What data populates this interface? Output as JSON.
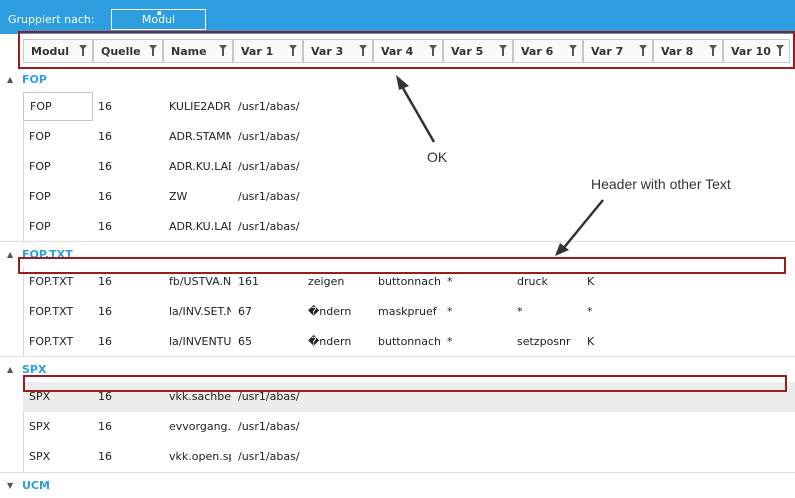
{
  "toolbar": {
    "group_by_label": "Gruppiert nach:",
    "group_chip": "Modul"
  },
  "columns": [
    "Modul",
    "Quelle",
    "Name",
    "Var 1",
    "Var 3",
    "Var 4",
    "Var 5",
    "Var 6",
    "Var 7",
    "Var 8",
    "Var 10"
  ],
  "groups": [
    {
      "name": "FOP",
      "rows": [
        [
          "FOP",
          "16",
          "KULIE2ADR",
          "/usr1/abas/",
          "",
          "",
          "",
          "",
          ""
        ],
        [
          "FOP",
          "16",
          "ADR.STAMM",
          "/usr1/abas/",
          "",
          "",
          "",
          "",
          ""
        ],
        [
          "FOP",
          "16",
          "ADR.KU.LAD",
          "/usr1/abas/",
          "",
          "",
          "",
          "",
          ""
        ],
        [
          "FOP",
          "16",
          "ZW",
          "/usr1/abas/",
          "",
          "",
          "",
          "",
          ""
        ],
        [
          "FOP",
          "16",
          "ADR.KU.LAD",
          "/usr1/abas/",
          "",
          "",
          "",
          "",
          ""
        ]
      ]
    },
    {
      "name": "FOP.TXT",
      "rows": [
        [
          "FOP.TXT",
          "16",
          "fb/USTVA.N",
          "161",
          "zeigen",
          "buttonnach",
          "*",
          "druck",
          "K"
        ],
        [
          "FOP.TXT",
          "16",
          "la/INV.SET.N",
          "67",
          "�ndern",
          "maskpruef",
          "*",
          "*",
          "*"
        ],
        [
          "FOP.TXT",
          "16",
          "la/INVENTU",
          "65",
          "�ndern",
          "buttonnach",
          "*",
          "setzposnr",
          "K"
        ]
      ]
    },
    {
      "name": "SPX",
      "rows": [
        [
          "SPX",
          "16",
          "vkk.sachbea",
          "/usr1/abas/",
          "",
          "",
          "",
          "",
          ""
        ],
        [
          "SPX",
          "16",
          "evvorgang.b",
          "/usr1/abas/",
          "",
          "",
          "",
          "",
          ""
        ],
        [
          "SPX",
          "16",
          "vkk.open.sp",
          "/usr1/abas/",
          "",
          "",
          "",
          "",
          ""
        ]
      ]
    },
    {
      "name": "UCM",
      "rows": []
    }
  ],
  "annotations": {
    "ok": "OK",
    "header_note": "Header with other Text"
  },
  "colors": {
    "accent": "#2d9ee0",
    "annotation": "#9b1c1c"
  }
}
